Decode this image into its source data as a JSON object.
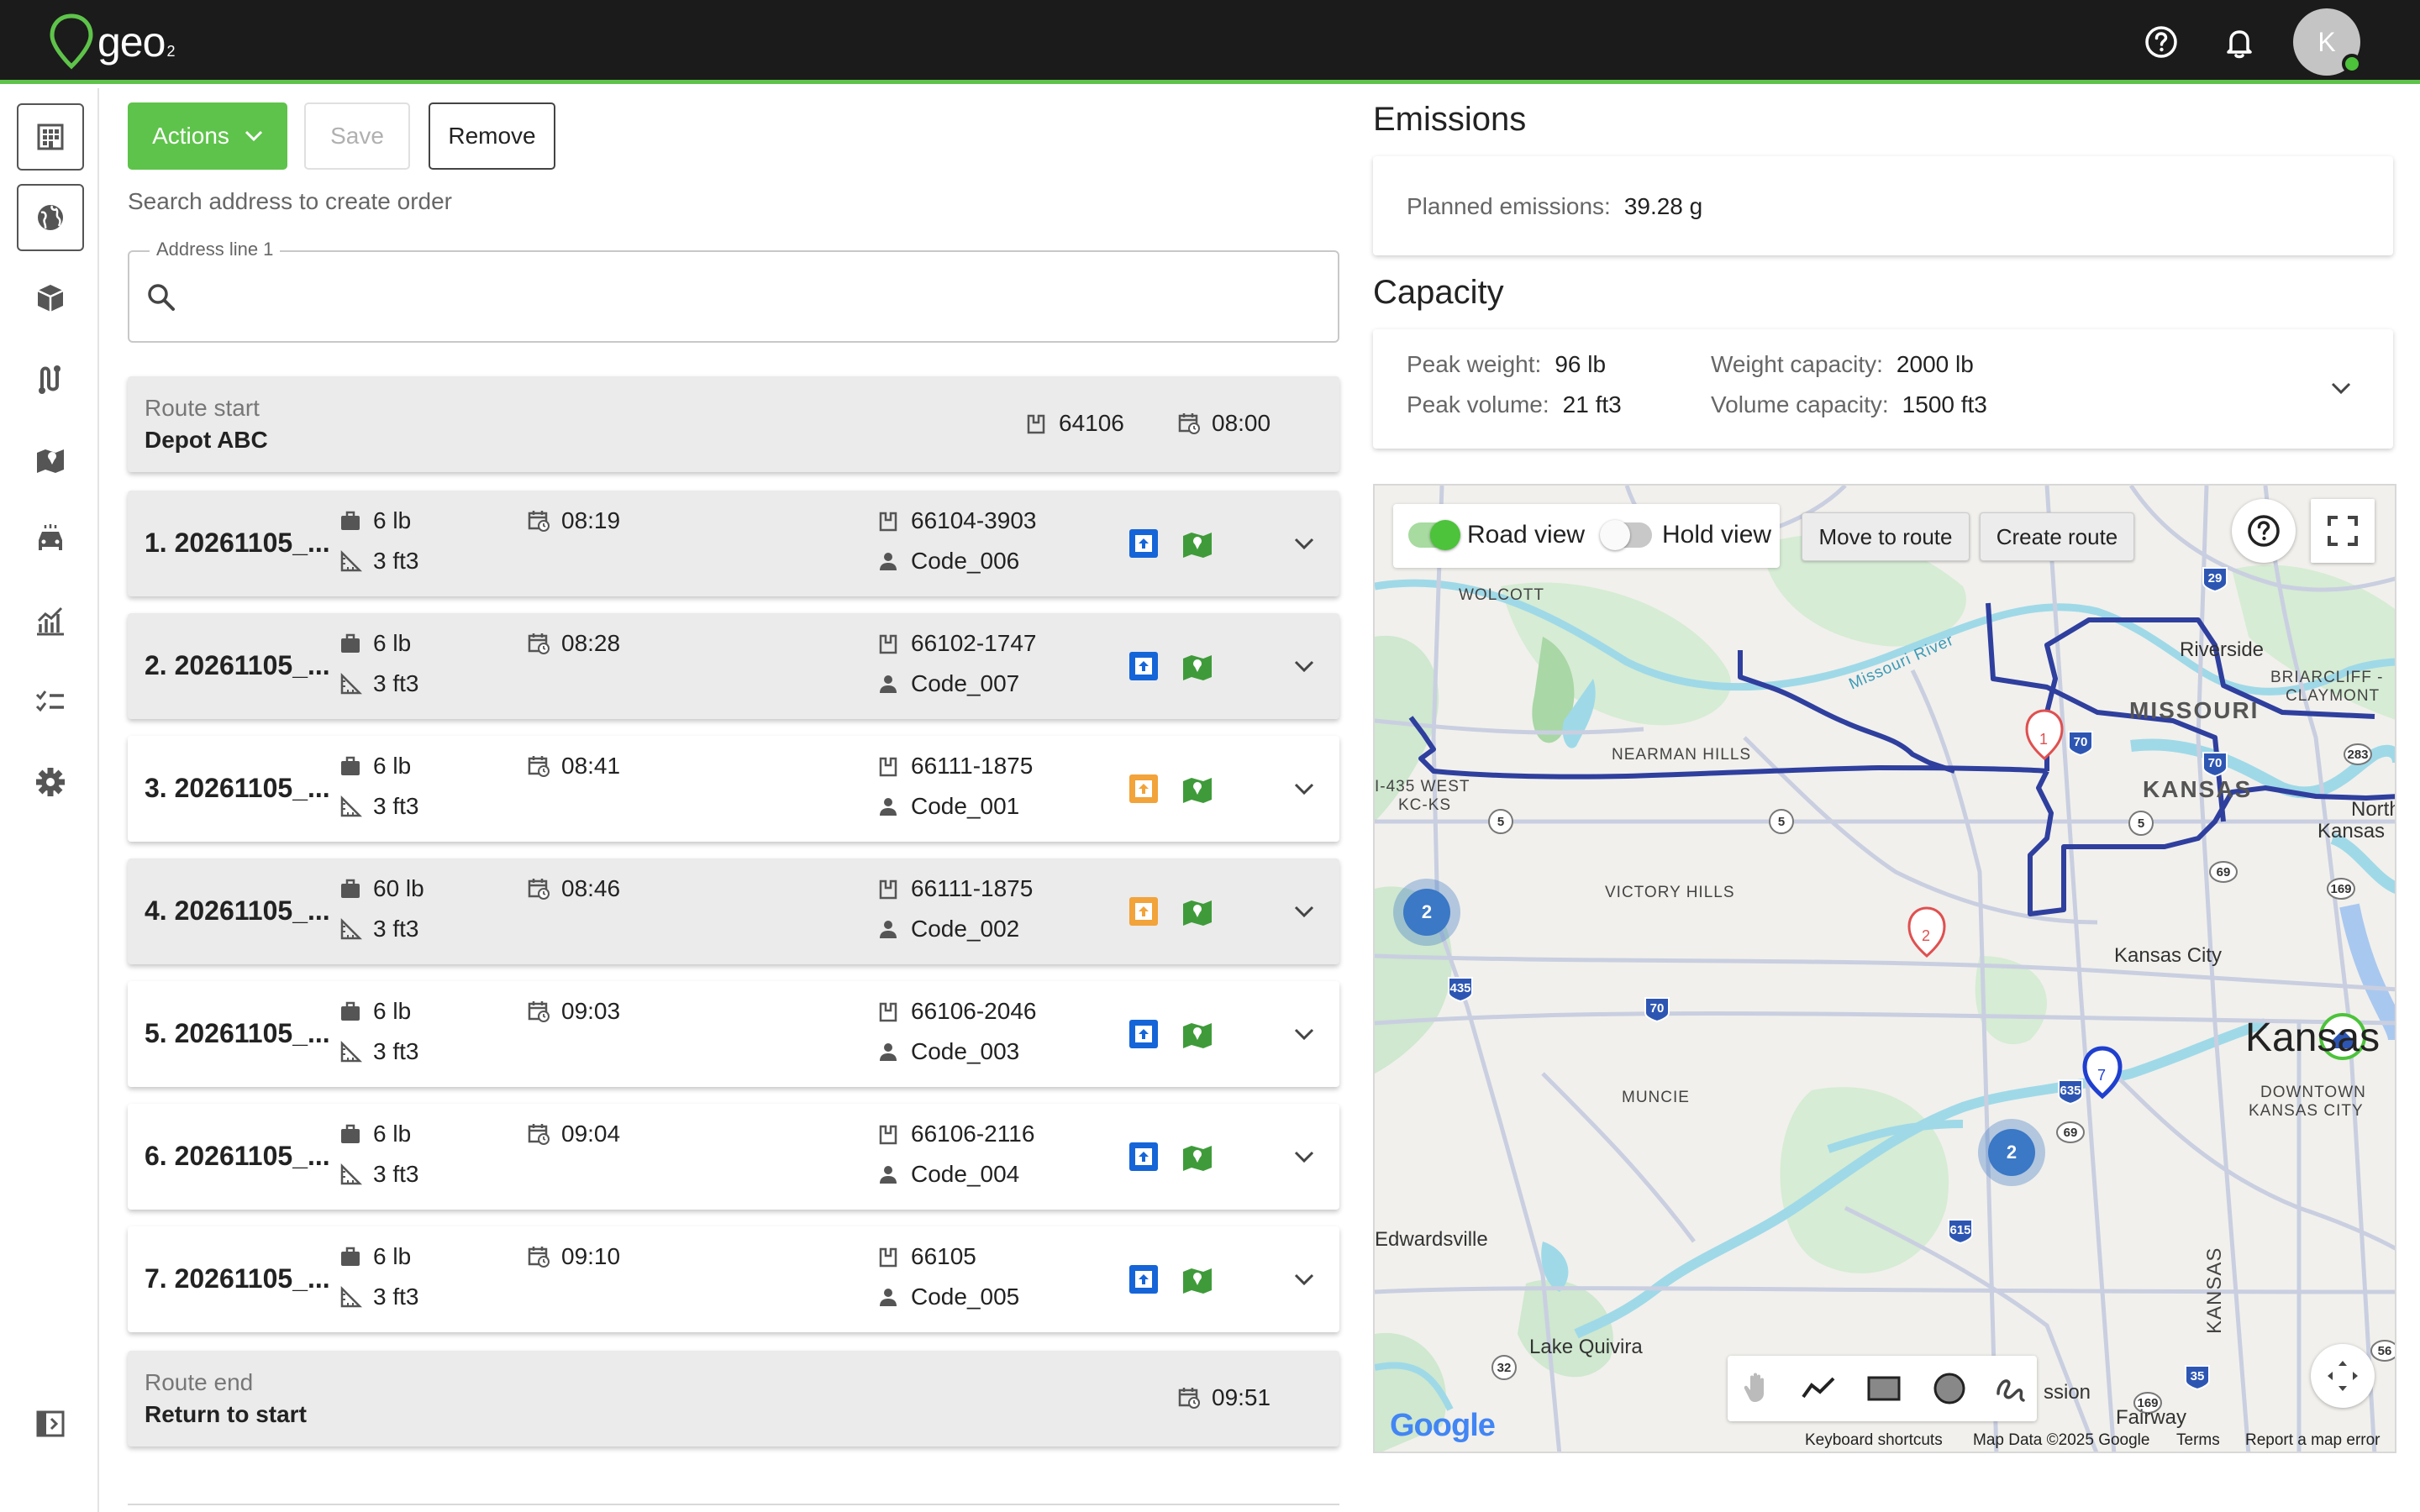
{
  "app": {
    "logo_text": "geo",
    "logo_sub": "2",
    "avatar_initial": "K",
    "brand_color": "#5ec34a"
  },
  "sidebar": {
    "items": [
      {
        "icon": "building-icon"
      },
      {
        "icon": "globe-icon",
        "active": true
      },
      {
        "icon": "package-icon"
      },
      {
        "icon": "route-icon"
      },
      {
        "icon": "map-icon"
      },
      {
        "icon": "vehicle-icon"
      },
      {
        "icon": "analytics-icon"
      },
      {
        "icon": "checklist-icon"
      },
      {
        "icon": "settings-icon"
      },
      {
        "icon": "collapse-panel-icon"
      }
    ]
  },
  "toolbar": {
    "actions_label": "Actions",
    "save_label": "Save",
    "remove_label": "Remove"
  },
  "search": {
    "hint": "Search address to create order",
    "field_label": "Address line 1",
    "value": ""
  },
  "route_start": {
    "label": "Route start",
    "name": "Depot ABC",
    "zip": "64106",
    "time": "08:00"
  },
  "stops": [
    {
      "title": "1. 20261105_...",
      "weight": "6 lb",
      "volume": "3 ft3",
      "time": "08:19",
      "zip": "66104-3903",
      "code": "Code_006",
      "type_color": "#1565d8"
    },
    {
      "title": "2. 20261105_...",
      "weight": "6 lb",
      "volume": "3 ft3",
      "time": "08:28",
      "zip": "66102-1747",
      "code": "Code_007",
      "type_color": "#1565d8"
    },
    {
      "title": "3. 20261105_...",
      "weight": "6 lb",
      "volume": "3 ft3",
      "time": "08:41",
      "zip": "66111-1875",
      "code": "Code_001",
      "type_color": "#f2a33a"
    },
    {
      "title": "4. 20261105_...",
      "weight": "60 lb",
      "volume": "3 ft3",
      "time": "08:46",
      "zip": "66111-1875",
      "code": "Code_002",
      "type_color": "#f2a33a"
    },
    {
      "title": "5. 20261105_...",
      "weight": "6 lb",
      "volume": "3 ft3",
      "time": "09:03",
      "zip": "66106-2046",
      "code": "Code_003",
      "type_color": "#1565d8"
    },
    {
      "title": "6. 20261105_...",
      "weight": "6 lb",
      "volume": "3 ft3",
      "time": "09:04",
      "zip": "66106-2116",
      "code": "Code_004",
      "type_color": "#1565d8"
    },
    {
      "title": "7. 20261105_...",
      "weight": "6 lb",
      "volume": "3 ft3",
      "time": "09:10",
      "zip": "66105",
      "code": "Code_005",
      "type_color": "#1565d8"
    }
  ],
  "route_end": {
    "label": "Route end",
    "name": "Return to start",
    "time": "09:51"
  },
  "emissions": {
    "title": "Emissions",
    "planned_label": "Planned emissions:",
    "planned_value": "39.28 g"
  },
  "capacity": {
    "title": "Capacity",
    "peak_weight_label": "Peak weight:",
    "peak_weight_value": "96 lb",
    "peak_volume_label": "Peak volume:",
    "peak_volume_value": "21 ft3",
    "weight_capacity_label": "Weight capacity:",
    "weight_capacity_value": "2000 lb",
    "volume_capacity_label": "Volume capacity:",
    "volume_capacity_value": "1500 ft3"
  },
  "map": {
    "road_view_label": "Road view",
    "road_view_on": true,
    "hold_view_label": "Hold view",
    "hold_view_on": false,
    "move_to_route_label": "Move to route",
    "create_route_label": "Create route",
    "labels": {
      "wolcott": "WOLCOTT",
      "riverside": "Riverside",
      "briarcliff": "BRIARCLIFF -",
      "claymont": "CLAYMONT",
      "missouri": "MISSOURI",
      "kansas_state": "KANSAS",
      "nearman": "NEARMAN HILLS",
      "i435": "I-435 WEST",
      "kcks": "KC-KS",
      "north_kansas": "North",
      "north_kansas2": "Kansas",
      "victory": "VICTORY HILLS",
      "kansas_city": "Kansas City",
      "kansas_big": "Kansas",
      "downtown": "DOWNTOWN",
      "downtown2": "KANSAS CITY",
      "muncie": "MUNCIE",
      "edwardsville": "Edwardsville",
      "lake_quivira": "Lake Quivira",
      "mission": "ssion",
      "fairway": "Fairway",
      "kansas_vert": "KANSAS",
      "missouri_river": "Missouri River"
    },
    "markers": [
      "1",
      "2",
      "7"
    ],
    "clusters": [
      "2",
      "2"
    ],
    "footer": {
      "google": "Google",
      "shortcuts": "Keyboard shortcuts",
      "map_data": "Map Data ©2025 Google",
      "terms": "Terms",
      "report": "Report a map error"
    }
  }
}
